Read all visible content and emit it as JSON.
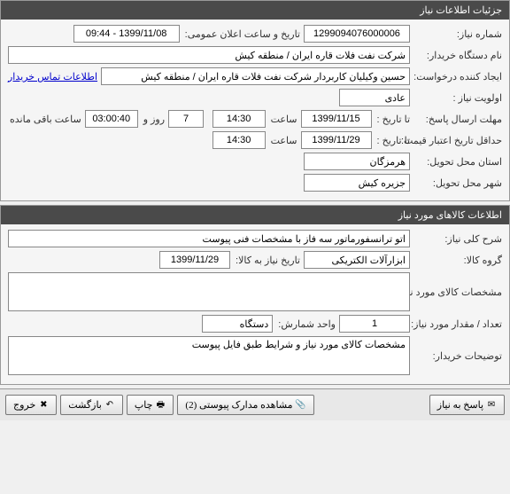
{
  "section1": {
    "title": "جزئیات اطلاعات نیاز",
    "need_number_label": "شماره نیاز:",
    "need_number": "1299094076000006",
    "announce_label": "تاریخ و ساعت اعلان عمومی:",
    "announce_value": "1399/11/08 - 09:44",
    "buyer_label": "نام دستگاه خریدار:",
    "buyer_value": "شرکت نفت فلات قاره ایران / منطقه کیش",
    "requester_label": "ایجاد کننده درخواست:",
    "requester_value": "حسین وکیلیان کاربردار شرکت نفت فلات قاره ایران / منطقه کیش",
    "contact_link": "اطلاعات تماس خریدار",
    "priority_label": "اولویت نیاز :",
    "priority_value": "عادی",
    "deadline_label": "مهلت ارسال پاسخ:",
    "to_date_label": "تا تاریخ :",
    "deadline_date": "1399/11/15",
    "time_label": "ساعت",
    "deadline_time": "14:30",
    "remain_days": "7",
    "day_and": "روز و",
    "remain_time": "03:00:40",
    "remain_label": "ساعت باقی مانده",
    "validity_label": "حداقل تاریخ اعتبار قیمت:",
    "validity_date": "1399/11/29",
    "validity_time": "14:30",
    "province_label": "استان محل تحویل:",
    "province_value": "هرمزگان",
    "city_label": "شهر محل تحویل:",
    "city_value": "جزیره کیش"
  },
  "section2": {
    "title": "اطلاعات کالاهای مورد نیاز",
    "desc_label": "شرح کلی نیاز:",
    "desc_value": "اتو ترانسفورماتور سه فاز با مشخصات فنی پیوست",
    "group_label": "گروه کالا:",
    "group_value": "ابزارآلات الکتریکی",
    "need_date_label": "تاریخ نیاز به کالا:",
    "need_date_value": "1399/11/29",
    "spec_label": "مشخصات کالای مورد نیاز:",
    "spec_value": "",
    "qty_label": "تعداد / مقدار مورد نیاز:",
    "qty_value": "1",
    "unit_label": "واحد شمارش:",
    "unit_value": "دستگاه",
    "buyer_notes_label": "توضیحات خریدار:",
    "buyer_notes_value": "مشخصات کالای مورد نیاز و شرایط طبق فایل پیوست"
  },
  "footer": {
    "respond": "پاسخ به نیاز",
    "attachments": "مشاهده مدارک پیوستی (2)",
    "print": "چاپ",
    "back": "بازگشت",
    "exit": "خروج"
  }
}
